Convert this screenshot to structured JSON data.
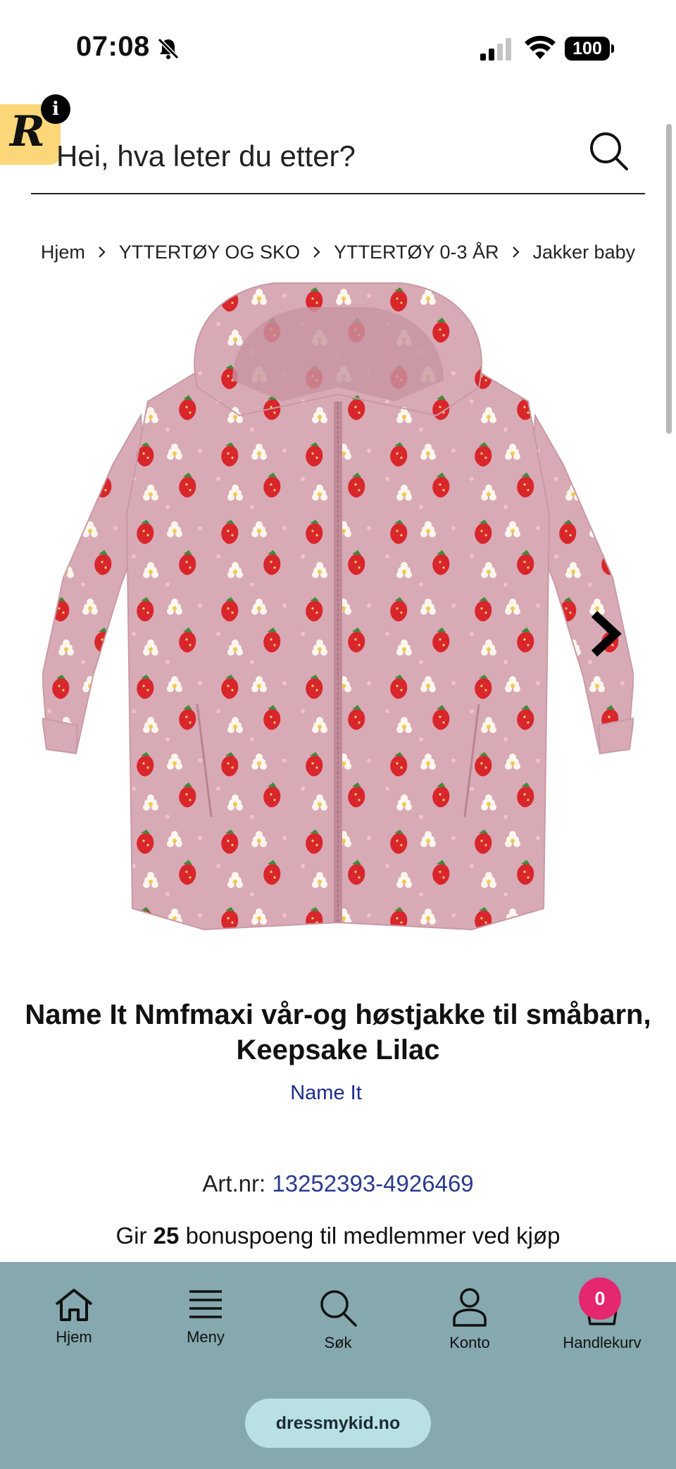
{
  "status_bar": {
    "time": "07:08",
    "battery": "100"
  },
  "review_badge": {
    "letter": "R",
    "info": "i"
  },
  "search": {
    "placeholder": "Hei, hva leter du etter?"
  },
  "breadcrumb": [
    "Hjem",
    "YTTERTØY OG SKO",
    "YTTERTØY 0-3 ÅR",
    "Jakker baby"
  ],
  "product": {
    "title_line1": "Name It Nmfmaxi vår-og høstjakke til småbarn,",
    "title_line2": "Keepsake Lilac",
    "brand": "Name It",
    "art_label": "Art.nr:",
    "art_number": "13252393-4926469",
    "bonus_prefix": "Gir",
    "bonus_points": "25",
    "bonus_suffix": "bonuspoeng til medlemmer ved kjøp"
  },
  "bottom_nav": {
    "items": [
      {
        "label": "Hjem",
        "icon": "home-icon"
      },
      {
        "label": "Meny",
        "icon": "menu-icon"
      },
      {
        "label": "Søk",
        "icon": "search-icon"
      },
      {
        "label": "Konto",
        "icon": "user-icon"
      },
      {
        "label": "Handlekurv",
        "icon": "cart-icon"
      }
    ],
    "cart_count": "0"
  },
  "browser": {
    "url": "dressmykid.no"
  },
  "colors": {
    "nav_bg": "#85a9ae",
    "badge": "#e4276e",
    "brand_link": "#1d2a8c",
    "review_badge": "#fbd77a"
  }
}
